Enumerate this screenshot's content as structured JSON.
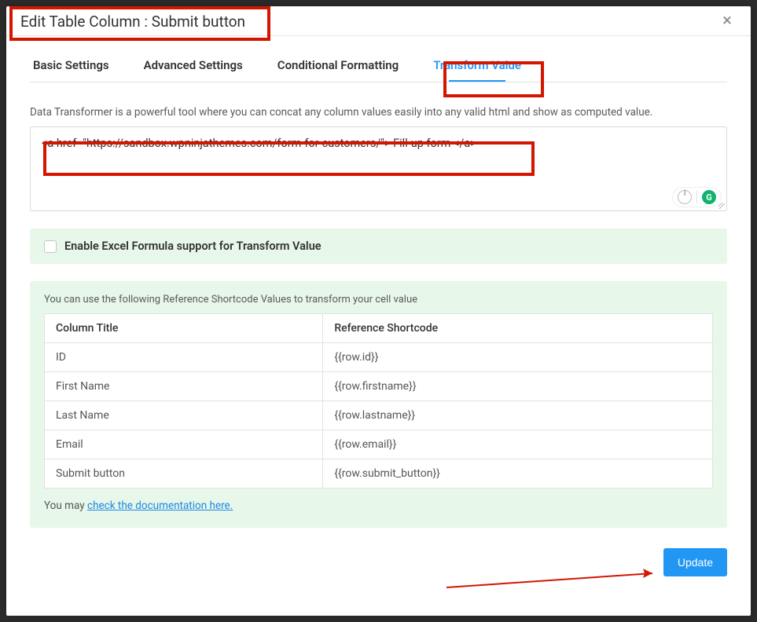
{
  "header": {
    "title": "Edit Table Column : Submit button"
  },
  "tabs": [
    {
      "label": "Basic Settings",
      "active": false
    },
    {
      "label": "Advanced Settings",
      "active": false
    },
    {
      "label": "Conditional Formatting",
      "active": false
    },
    {
      "label": "Transform Value",
      "active": true
    }
  ],
  "description": "Data Transformer is a powerful tool where you can concat any column values easily into any valid html and show as computed value.",
  "editor": {
    "value": "<a href=\"https://sandbox.wpninjathemes.com/form-for-customers/\"> Fill-up form </a>"
  },
  "excelSupport": {
    "checked": false,
    "label": "Enable Excel Formula support for Transform Value"
  },
  "reference": {
    "hint": "You can use the following Reference Shortcode Values to transform your cell value",
    "columns": [
      "Column Title",
      "Reference Shortcode"
    ],
    "rows": [
      {
        "title": "ID",
        "code": "{{row.id}}"
      },
      {
        "title": "First Name",
        "code": "{{row.firstname}}"
      },
      {
        "title": "Last Name",
        "code": "{{row.lastname}}"
      },
      {
        "title": "Email",
        "code": "{{row.email}}"
      },
      {
        "title": "Submit button",
        "code": "{{row.submit_button}}"
      }
    ],
    "docPrefix": "You may ",
    "docLink": "check the documentation here."
  },
  "footer": {
    "update": "Update"
  }
}
